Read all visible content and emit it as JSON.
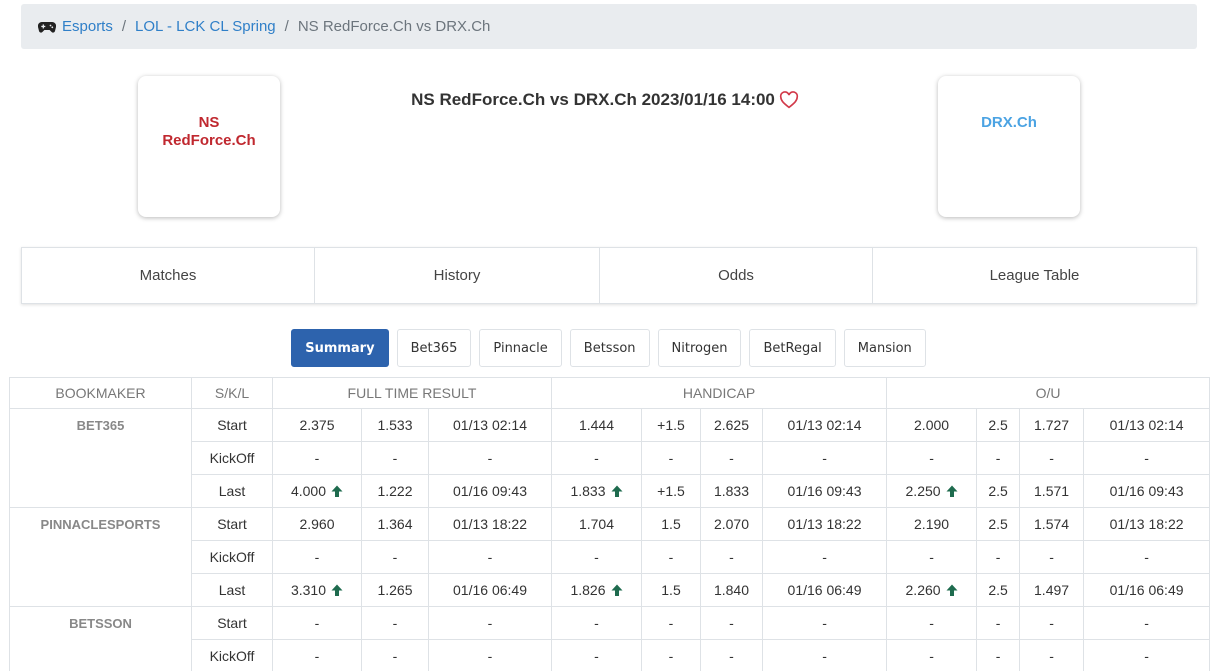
{
  "breadcrumb": {
    "icon": "gamepad-icon",
    "items": [
      "Esports",
      "LOL - LCK CL Spring"
    ],
    "current": "NS RedForce.Ch vs DRX.Ch"
  },
  "match": {
    "home_team": "NS RedForce.Ch",
    "away_team": "DRX.Ch",
    "title": "NS RedForce.Ch vs DRX.Ch 2023/01/16 14:00",
    "home_color": "#c0282f",
    "away_color": "#4ba3e3"
  },
  "tabs": [
    "Matches",
    "History",
    "Odds",
    "League Table"
  ],
  "bookmaker_buttons": {
    "active": "Summary",
    "items": [
      "Summary",
      "Bet365",
      "Pinnacle",
      "Betsson",
      "Nitrogen",
      "BetRegal",
      "Mansion"
    ]
  },
  "table": {
    "headers": {
      "bookmaker": "BOOKMAKER",
      "skl": "S/K/L",
      "ftr": "FULL TIME RESULT",
      "handicap": "HANDICAP",
      "ou": "O/U"
    },
    "groups": [
      {
        "name": "BET365",
        "rows": [
          {
            "label": "Start",
            "cells": [
              [
                "2.375",
                false
              ],
              [
                "1.533",
                false
              ],
              [
                "01/13 02:14",
                false
              ],
              [
                "1.444",
                false
              ],
              [
                "+1.5",
                false
              ],
              [
                "2.625",
                false
              ],
              [
                "01/13 02:14",
                false
              ],
              [
                "2.000",
                false
              ],
              [
                "2.5",
                false
              ],
              [
                "1.727",
                false
              ],
              [
                "01/13 02:14",
                false
              ]
            ]
          },
          {
            "label": "KickOff",
            "cells": [
              [
                "-",
                false
              ],
              [
                "-",
                false
              ],
              [
                "-",
                false
              ],
              [
                "-",
                false
              ],
              [
                "-",
                false
              ],
              [
                "-",
                false
              ],
              [
                "-",
                false
              ],
              [
                "-",
                false
              ],
              [
                "-",
                false
              ],
              [
                "-",
                false
              ],
              [
                "-",
                false
              ]
            ]
          },
          {
            "label": "Last",
            "cells": [
              [
                "4.000",
                true
              ],
              [
                "1.222",
                false
              ],
              [
                "01/16 09:43",
                false
              ],
              [
                "1.833",
                true
              ],
              [
                "+1.5",
                false
              ],
              [
                "1.833",
                false
              ],
              [
                "01/16 09:43",
                false
              ],
              [
                "2.250",
                true
              ],
              [
                "2.5",
                false
              ],
              [
                "1.571",
                false
              ],
              [
                "01/16 09:43",
                false
              ]
            ]
          }
        ]
      },
      {
        "name": "PINNACLESPORTS",
        "rows": [
          {
            "label": "Start",
            "cells": [
              [
                "2.960",
                false
              ],
              [
                "1.364",
                false
              ],
              [
                "01/13 18:22",
                false
              ],
              [
                "1.704",
                false
              ],
              [
                "1.5",
                false
              ],
              [
                "2.070",
                false
              ],
              [
                "01/13 18:22",
                false
              ],
              [
                "2.190",
                false
              ],
              [
                "2.5",
                false
              ],
              [
                "1.574",
                false
              ],
              [
                "01/13 18:22",
                false
              ]
            ]
          },
          {
            "label": "KickOff",
            "cells": [
              [
                "-",
                false
              ],
              [
                "-",
                false
              ],
              [
                "-",
                false
              ],
              [
                "-",
                false
              ],
              [
                "-",
                false
              ],
              [
                "-",
                false
              ],
              [
                "-",
                false
              ],
              [
                "-",
                false
              ],
              [
                "-",
                false
              ],
              [
                "-",
                false
              ],
              [
                "-",
                false
              ]
            ]
          },
          {
            "label": "Last",
            "cells": [
              [
                "3.310",
                true
              ],
              [
                "1.265",
                false
              ],
              [
                "01/16 06:49",
                false
              ],
              [
                "1.826",
                true
              ],
              [
                "1.5",
                false
              ],
              [
                "1.840",
                false
              ],
              [
                "01/16 06:49",
                false
              ],
              [
                "2.260",
                true
              ],
              [
                "2.5",
                false
              ],
              [
                "1.497",
                false
              ],
              [
                "01/16 06:49",
                false
              ]
            ]
          }
        ]
      },
      {
        "name": "BETSSON",
        "rows": [
          {
            "label": "Start",
            "cells": [
              [
                "-",
                false
              ],
              [
                "-",
                false
              ],
              [
                "-",
                false
              ],
              [
                "-",
                false
              ],
              [
                "-",
                false
              ],
              [
                "-",
                false
              ],
              [
                "-",
                false
              ],
              [
                "-",
                false
              ],
              [
                "-",
                false
              ],
              [
                "-",
                false
              ],
              [
                "-",
                false
              ]
            ]
          },
          {
            "label": "KickOff",
            "cells": [
              [
                "-",
                false
              ],
              [
                "-",
                false
              ],
              [
                "-",
                false
              ],
              [
                "-",
                false
              ],
              [
                "-",
                false
              ],
              [
                "-",
                false
              ],
              [
                "-",
                false
              ],
              [
                "-",
                false
              ],
              [
                "-",
                false
              ],
              [
                "-",
                false
              ],
              [
                "-",
                false
              ]
            ]
          }
        ]
      }
    ],
    "up_arrow_color": "#1e6b4e"
  }
}
